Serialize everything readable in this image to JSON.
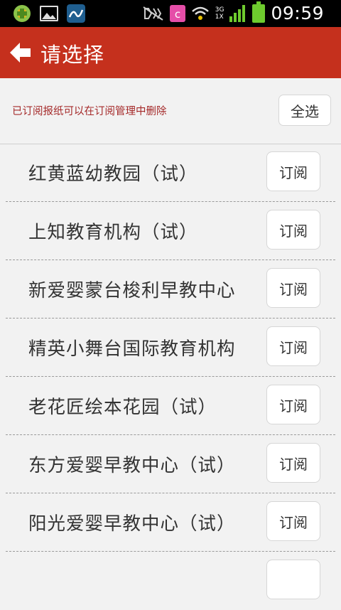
{
  "status_bar": {
    "time": "09:59",
    "network_label_top": "3G",
    "network_label_bottom": "1X",
    "icons": [
      "app-icon",
      "image-icon",
      "wave-app-icon",
      "mute-icon",
      "c-app-icon",
      "wifi-icon",
      "signal-icon",
      "battery-icon"
    ]
  },
  "header": {
    "title": "请选择",
    "back_icon": "back-arrow-icon",
    "bar_color": "#c5301d"
  },
  "notice": {
    "text": "已订阅报纸可以在订阅管理中删除",
    "select_all_label": "全选"
  },
  "list": {
    "items": [
      {
        "name": "红黄蓝幼教园（试）",
        "button": "订阅"
      },
      {
        "name": "上知教育机构（试）",
        "button": "订阅"
      },
      {
        "name": "新爱婴蒙台梭利早教中心",
        "button": "订阅"
      },
      {
        "name": "精英小舞台国际教育机构",
        "button": "订阅"
      },
      {
        "name": "老花匠绘本花园（试）",
        "button": "订阅"
      },
      {
        "name": "东方爱婴早教中心（试）",
        "button": "订阅"
      },
      {
        "name": "阳光爱婴早教中心（试）",
        "button": "订阅"
      },
      {
        "name": "",
        "button": ""
      }
    ]
  }
}
